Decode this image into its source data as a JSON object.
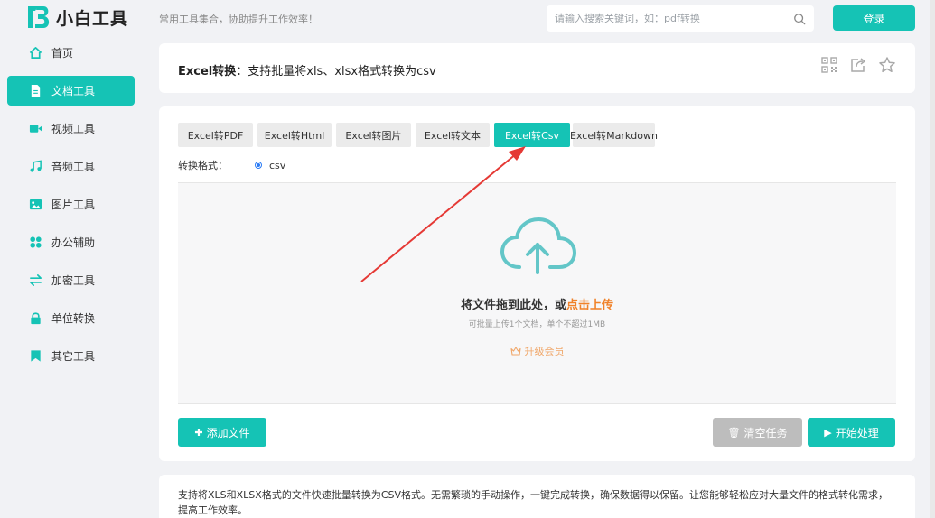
{
  "header": {
    "brand_name": "小白工具",
    "slogan": "常用工具集合，协助提升工作效率！",
    "search_placeholder": "请输入搜索关键词，如：pdf转换",
    "login_label": "登录"
  },
  "sidebar": {
    "items": [
      {
        "label": "首页",
        "icon": "home-icon",
        "active": false
      },
      {
        "label": "文档工具",
        "icon": "document-icon",
        "active": true
      },
      {
        "label": "视频工具",
        "icon": "video-icon",
        "active": false
      },
      {
        "label": "音频工具",
        "icon": "music-icon",
        "active": false
      },
      {
        "label": "图片工具",
        "icon": "image-icon",
        "active": false
      },
      {
        "label": "办公辅助",
        "icon": "grid-icon",
        "active": false
      },
      {
        "label": "加密工具",
        "icon": "swap-icon",
        "active": false
      },
      {
        "label": "单位转换",
        "icon": "lock-icon",
        "active": false
      },
      {
        "label": "其它工具",
        "icon": "bookmark-icon",
        "active": false
      }
    ]
  },
  "title_card": {
    "title_bold": "Excel转换",
    "title_rest": "：支持批量将xls、xlsx格式转换为csv"
  },
  "tabs": [
    {
      "label": "Excel转PDF",
      "active": false
    },
    {
      "label": "Excel转Html",
      "active": false
    },
    {
      "label": "Excel转图片",
      "active": false
    },
    {
      "label": "Excel转文本",
      "active": false
    },
    {
      "label": "Excel转Csv",
      "active": true
    },
    {
      "label": "Excel转Markdown",
      "active": false
    }
  ],
  "format": {
    "label": "转换格式：",
    "option": "csv"
  },
  "dropzone": {
    "main_text": "将文件拖到此处，或",
    "link_text": "点击上传",
    "sub_text": "可批量上传1个文档，单个不超过1MB",
    "upgrade_text": "升级会员"
  },
  "actions": {
    "add_label": "添加文件",
    "clear_label": "清空任务",
    "start_label": "开始处理"
  },
  "description": "支持将XLS和XLSX格式的文件快速批量转换为CSV格式。无需繁琐的手动操作，一键完成转换，确保数据得以保留。让您能够轻松应对大量文件的格式转化需求，提高工作效率。",
  "colors": {
    "accent": "#15c3b5",
    "link": "#f0822a",
    "arrow": "#e53935"
  }
}
